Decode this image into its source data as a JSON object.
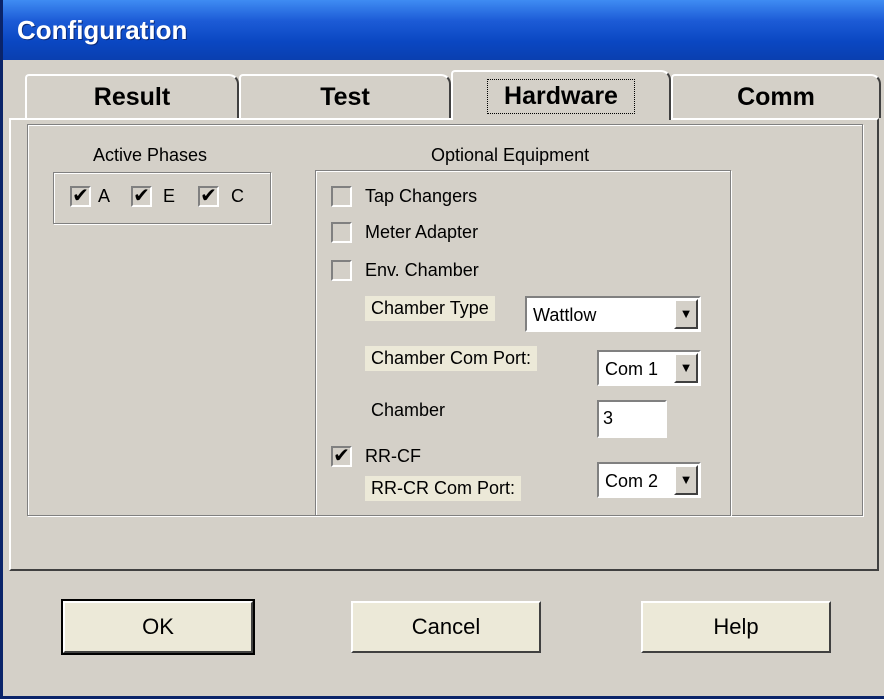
{
  "window": {
    "title": "Configuration"
  },
  "tabs": [
    {
      "label": "Result",
      "selected": false
    },
    {
      "label": "Test",
      "selected": false
    },
    {
      "label": "Hardware",
      "selected": true
    },
    {
      "label": "Comm",
      "selected": false
    }
  ],
  "active_phases": {
    "title": "Active Phases",
    "phases": [
      {
        "label": "A",
        "checked": true
      },
      {
        "label": "E",
        "checked": true
      },
      {
        "label": "C",
        "checked": true
      }
    ]
  },
  "optional_equipment": {
    "title": "Optional Equipment",
    "tap_changers": {
      "label": "Tap Changers",
      "checked": false
    },
    "meter_adapter": {
      "label": "Meter Adapter",
      "checked": false
    },
    "env_chamber": {
      "label": "Env. Chamber",
      "checked": false
    },
    "chamber_type": {
      "label": "Chamber Type",
      "value": "Wattlow"
    },
    "chamber_com_port": {
      "label": "Chamber Com Port:",
      "value": "Com 1"
    },
    "chamber": {
      "label": "Chamber",
      "value": "3"
    },
    "rr_cf": {
      "label": "RR-CF",
      "checked": true
    },
    "rr_cr_com_port": {
      "label": "RR-CR Com Port:",
      "value": "Com 2"
    }
  },
  "buttons": {
    "ok": "OK",
    "cancel": "Cancel",
    "help": "Help"
  },
  "glyphs": {
    "check": "✔",
    "dropdown_arrow": "▼"
  }
}
